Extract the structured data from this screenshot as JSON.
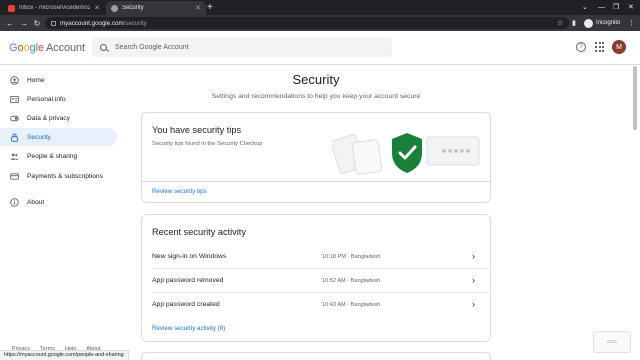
{
  "browser": {
    "tabs": [
      {
        "title": "Inbox - microservicedemo27@g",
        "active": false
      },
      {
        "title": "Security",
        "active": true
      }
    ],
    "url_host": "myaccount.google.com",
    "url_path": "/security",
    "incognito_label": "Incognito",
    "status_url": "https://myaccount.google.com/people-and-sharing"
  },
  "header": {
    "logo_letters": [
      "G",
      "o",
      "o",
      "g",
      "l",
      "e"
    ],
    "logo_suffix": "Account",
    "search_placeholder": "Search Google Account",
    "avatar_initial": "M"
  },
  "sidebar": {
    "items": [
      {
        "label": "Home",
        "icon": "account-circle-icon",
        "selected": false
      },
      {
        "label": "Personal info",
        "icon": "id-card-icon",
        "selected": false
      },
      {
        "label": "Data & privacy",
        "icon": "toggle-icon",
        "selected": false
      },
      {
        "label": "Security",
        "icon": "lock-icon",
        "selected": true
      },
      {
        "label": "People & sharing",
        "icon": "people-icon",
        "selected": false
      },
      {
        "label": "Payments & subscriptions",
        "icon": "credit-card-icon",
        "selected": false
      },
      {
        "label": "About",
        "icon": "info-icon",
        "selected": false
      }
    ],
    "footer": [
      "Privacy",
      "Terms",
      "Help",
      "About"
    ]
  },
  "main": {
    "title": "Security",
    "subtitle": "Settings and recommendations to help you keep your account secure",
    "tips_card": {
      "title": "You have security tips",
      "desc": "Security tips found in the Security Checkup",
      "link": "Review security tips"
    },
    "activity_card": {
      "title": "Recent security activity",
      "events": [
        {
          "event": "New sign-in on Windows",
          "when": "10:18 PM · Bangladesh"
        },
        {
          "event": "App password removed",
          "when": "10:52 AM · Bangladesh"
        },
        {
          "event": "App password created",
          "when": "10:43 AM · Bangladesh"
        }
      ],
      "link": "Review security activity (8)"
    }
  },
  "colors": {
    "accent": "#1a73e8",
    "shield": "#188038",
    "selected_bg": "#e8f0fe"
  }
}
